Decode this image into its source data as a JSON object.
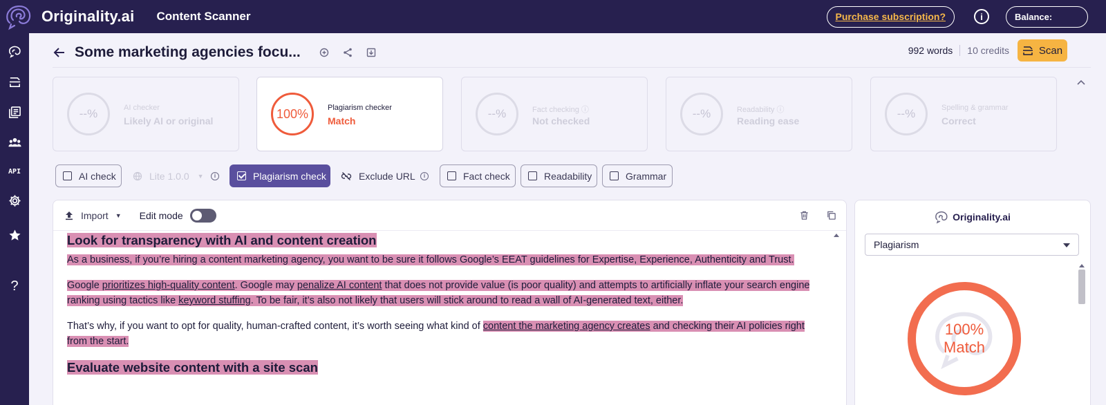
{
  "topbar": {
    "brand_name": "Originality.ai",
    "product_name": "Content Scanner",
    "purchase_label": "Purchase subscription?",
    "info_glyph": "i",
    "balance_label": "Balance:"
  },
  "sidebar": {
    "items": [
      {
        "icon": "brain-icon"
      },
      {
        "icon": "scan-document-icon"
      },
      {
        "icon": "library-icon"
      },
      {
        "icon": "team-icon"
      },
      {
        "icon": "api-icon",
        "label": "API"
      },
      {
        "icon": "gear-icon"
      },
      {
        "icon": "star-icon"
      },
      {
        "icon": "help-icon",
        "label": "?"
      }
    ]
  },
  "header": {
    "title": "Some marketing agencies focu...",
    "word_count": "992 words",
    "credits": "10 credits",
    "scan_label": "Scan"
  },
  "cards": [
    {
      "percent": "--%",
      "label": "AI checker",
      "value": "Likely AI or original",
      "active": false
    },
    {
      "percent": "100%",
      "label": "Plagiarism checker",
      "value": "Match",
      "active": true
    },
    {
      "percent": "--%",
      "label": "Fact checking ⓘ",
      "value": "Not checked",
      "active": false
    },
    {
      "percent": "--%",
      "label": "Readability ⓘ",
      "value": "Reading ease",
      "active": false
    },
    {
      "percent": "--%",
      "label": "Spelling & grammar",
      "value": "Correct",
      "active": false
    }
  ],
  "options": {
    "ai_check": "AI check",
    "model": "Lite 1.0.0",
    "plagiarism_check": "Plagiarism check",
    "exclude_url": "Exclude URL",
    "fact_check": "Fact check",
    "readability": "Readability",
    "grammar": "Grammar"
  },
  "editor": {
    "import_label": "Import",
    "edit_mode_label": "Edit mode",
    "h1": "Look for transparency with AI and content creation",
    "p1": "As a business, if you’re hiring a content marketing agency, you want to be sure it follows Google’s EEAT guidelines for Expertise, Experience, Authenticity and Trust.",
    "p2_a": "Google ",
    "p2_link1": "prioritizes high-quality content",
    "p2_b": ". Google may ",
    "p2_link2": "penalize AI content",
    "p2_c": " that does not provide value (is poor quality) and attempts to artificially inflate your search engine ranking using tactics like ",
    "p2_link3": "keyword stuffing",
    "p2_d": ". To be fair, it’s also not likely that users will stick around to read a wall of AI-generated text, either.",
    "p3_a": "That’s why, if you want to opt for quality, human-crafted content, it’s worth seeing what kind of ",
    "p3_link": "content the marketing agency creates",
    "p3_b": " and checking their AI policies right from the start.",
    "h2": "Evaluate website content with a site scan"
  },
  "results": {
    "brand": "Originality.ai",
    "selected_type": "Plagiarism",
    "percent": "100%",
    "label": "Match"
  },
  "colors": {
    "nav_bg": "#27204f",
    "accent": "#5a4f9e",
    "scan": "#f6b442",
    "match": "#ef5b3b",
    "highlight": "#d98fb3"
  }
}
